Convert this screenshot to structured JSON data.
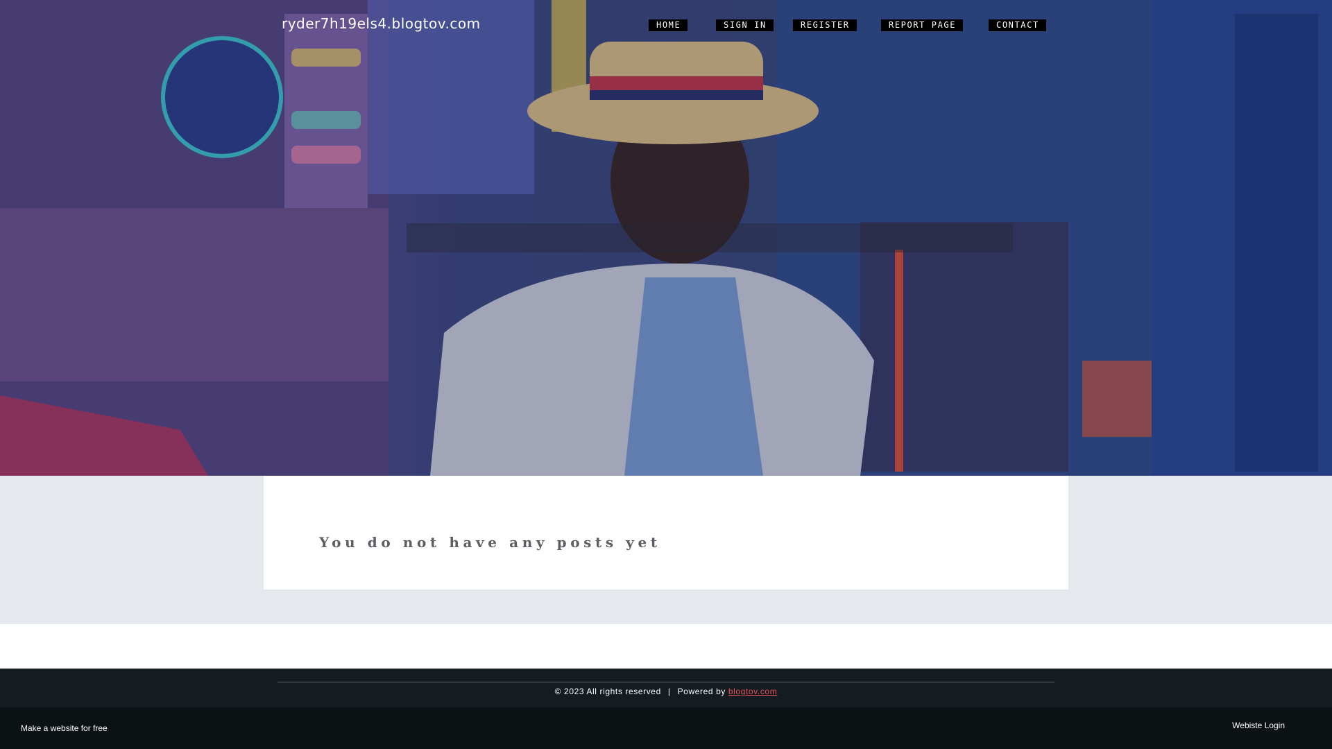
{
  "header": {
    "site_title": "ryder7h19els4.blogtov.com",
    "nav": [
      {
        "label": "HOME"
      },
      {
        "label": "SIGN IN"
      },
      {
        "label": "REGISTER"
      },
      {
        "label": "REPORT PAGE"
      },
      {
        "label": "CONTACT"
      }
    ]
  },
  "hero": {
    "image_icon": "hero-photo"
  },
  "main": {
    "empty_message": "You do not have any posts yet"
  },
  "footer": {
    "copyright": "© 2023 All rights reserved",
    "separator": "|",
    "powered_by": "Powered by",
    "powered_link": "blogtov.com",
    "link_color": "#e8505b"
  },
  "bottom_bar": {
    "make_site": "Make a website for free",
    "login": "Webiste Login"
  }
}
